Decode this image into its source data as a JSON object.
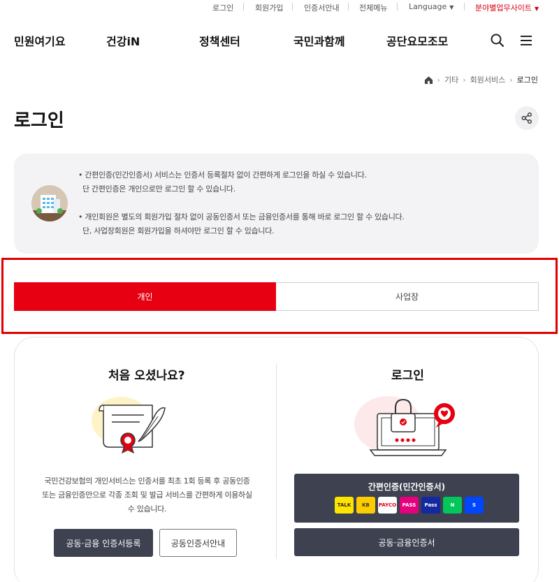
{
  "util_bar": {
    "login": "로그인",
    "signup": "회원가입",
    "cert_guide": "인증서안내",
    "sitemap": "전체메뉴",
    "language": "Language",
    "field_sites": "분야별업무사이트"
  },
  "gnb": {
    "items": [
      "민원여기요",
      "건강iN",
      "정책센터",
      "국민과함께",
      "공단요모조모"
    ]
  },
  "breadcrumb": {
    "items": [
      "기타",
      "회원서비스",
      "로그인"
    ]
  },
  "page_title": "로그인",
  "info": {
    "lines": [
      "• 간편인증(민간인증서) 서비스는 인증서 등록절차 없이 간편하게 로그인을 하실 수 있습니다.",
      "단 간편인증은 개인으로만 로그인 할 수 있습니다.",
      "• 개인회원은 별도의 회원가입 절차 없이 공동인증서 또는 금융인증서를 통해 바로 로그인 할 수 있습니다.",
      "단, 사업장회원은 회원가입을 하셔야만 로그인 할 수 있습니다."
    ]
  },
  "tabs": {
    "personal": "개인",
    "business": "사업장"
  },
  "left": {
    "title": "처음 오셨나요?",
    "desc": [
      "국민건강보험의 개인서비스는 인증서를 최초 1회 등록 후 공동인증",
      "또는 금융인증만으로 각종 조회 및 발급 서비스를 간편하게 이용하실",
      "수 있습니다."
    ],
    "register_button": "공동·금융 인증서등록",
    "guide_button": "공동인증서안내"
  },
  "right": {
    "title": "로그인",
    "simple_auth_button": "간편인증(민간인증서)",
    "cert_button": "공동·금융인증서",
    "providers": [
      {
        "icon": "kakao-talk-icon",
        "text": "TALK",
        "bg": "#fee500",
        "fg": "#3a1d1d"
      },
      {
        "icon": "kb-icon",
        "text": "KB",
        "bg": "#ffcc00",
        "fg": "#333333"
      },
      {
        "icon": "payco-icon",
        "text": "PAYCO",
        "bg": "#ffffff",
        "fg": "#e60012"
      },
      {
        "icon": "pass-icon",
        "text": "PASS",
        "bg": "#e6007e",
        "fg": "#ffffff"
      },
      {
        "icon": "samsung-pass-icon",
        "text": "Pass",
        "bg": "#1428a0",
        "fg": "#ffffff"
      },
      {
        "icon": "naver-icon",
        "text": "N",
        "bg": "#03c75a",
        "fg": "#ffffff"
      },
      {
        "icon": "shinhan-icon",
        "text": "S",
        "bg": "#0046ff",
        "fg": "#ffffff"
      }
    ]
  },
  "colors": {
    "accent": "#e60012",
    "dark_button": "#3d4150"
  }
}
